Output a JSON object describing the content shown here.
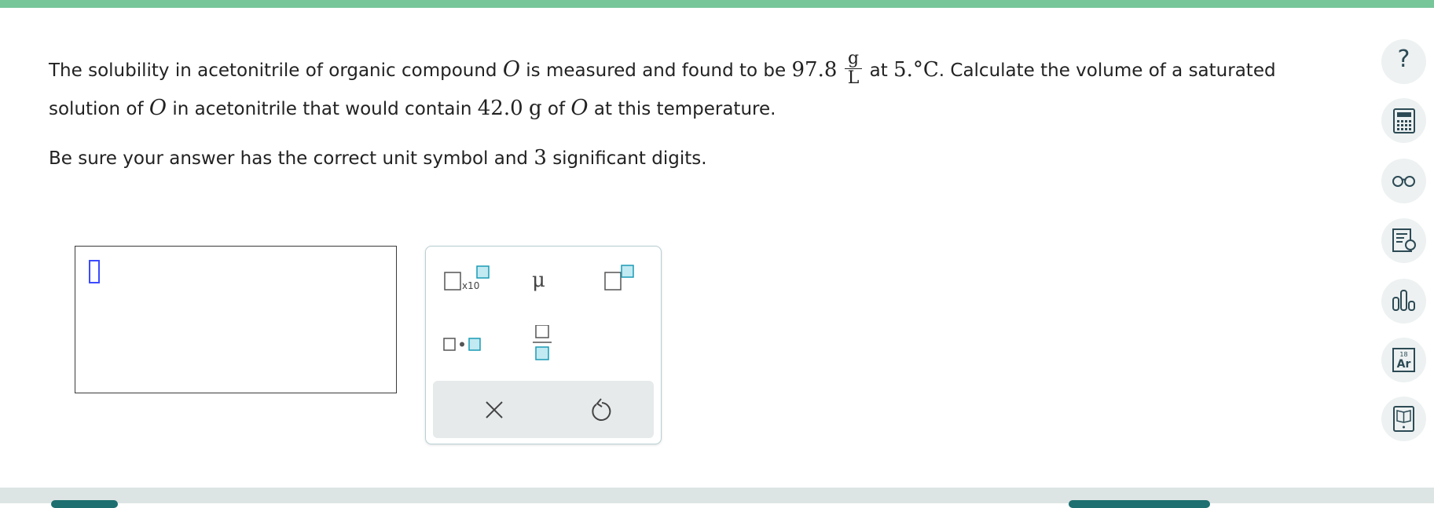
{
  "question": {
    "line1_pre": "The solubility in acetonitrile of organic compound",
    "compound_symbol": "O",
    "line1_mid": "is measured and found to be",
    "solubility_value": "97.8",
    "unit_numerator": "g",
    "unit_denominator": "L",
    "at_label": "at",
    "temperature_value": "5.",
    "temperature_unit": "°C",
    "line1_post": ". Calculate the volume of a saturated",
    "line2_pre": "solution of",
    "line2_mid": "in acetonitrile that would contain",
    "mass_value": "42.0",
    "mass_unit": "g",
    "of_label": "of",
    "line2_post": "at this temperature.",
    "line3_pre": "Be sure your answer has the correct unit symbol and",
    "sig_digits": "3",
    "line3_post": "significant digits."
  },
  "palette": {
    "x10_label": "x10",
    "mu_label": "μ",
    "buttons": [
      "scientific-notation",
      "micro-prefix",
      "superscript",
      "multiply-dot",
      "fraction",
      "clear",
      "undo"
    ]
  },
  "sidebar": {
    "help_label": "?",
    "periodic_number": "18",
    "periodic_symbol": "Ar"
  },
  "colors": {
    "accent_green": "#76c69a",
    "teal_icon": "#1a9bb5",
    "cursor_blue": "#3c4bff",
    "icon_dark": "#2c4a55"
  }
}
